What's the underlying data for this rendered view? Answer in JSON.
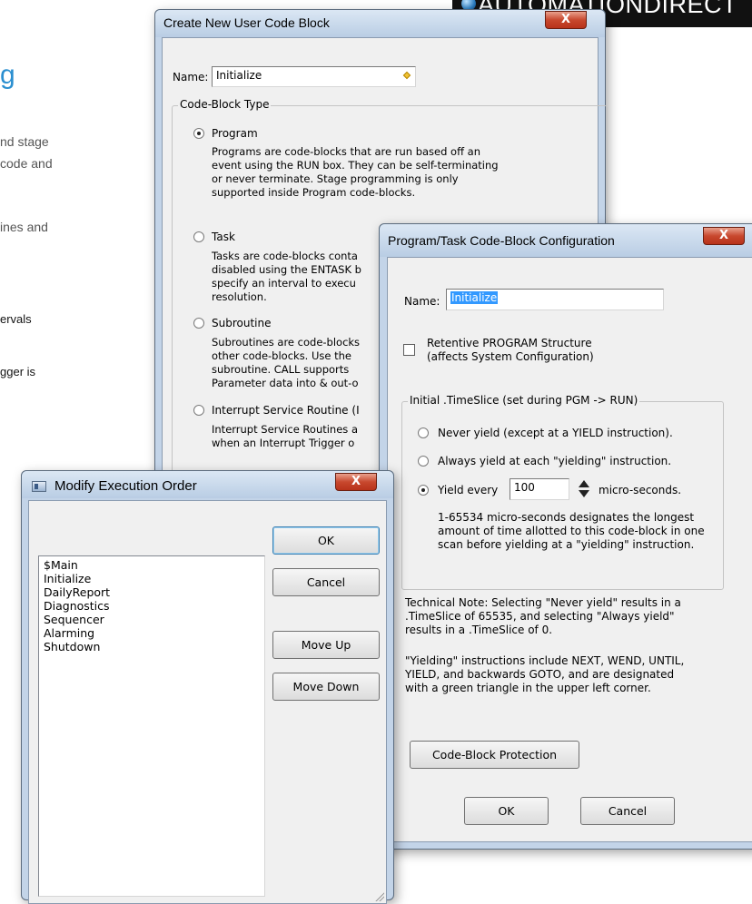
{
  "background_page": {
    "heading_fragment": "g",
    "lines": [
      "nd stage",
      "code and",
      "ines and",
      "ervals",
      "gger is"
    ],
    "brand": "AUTOMATIONDIRECT"
  },
  "create_block_dialog": {
    "title": "Create New User Code Block",
    "close_label": "X",
    "name_label": "Name:",
    "name_value": "Initialize",
    "group_label": "Code-Block Type",
    "options": [
      {
        "label": "Program",
        "checked": true,
        "description": "Programs are code-blocks that are run based off an event using the RUN box. They can be self-terminating or never terminate.  Stage programming is only supported inside Program code-blocks."
      },
      {
        "label": "Task",
        "checked": false,
        "description": "Tasks are code-blocks conta disabled using the ENTASK b specify an interval to execu resolution."
      },
      {
        "label": "Subroutine",
        "checked": false,
        "description": "Subroutines are code-blocks other code-blocks.  Use the subroutine.  CALL supports Parameter data into & out-o"
      },
      {
        "label": "Interrupt Service Routine (I",
        "checked": false,
        "description": "Interrupt Service Routines a when an Interrupt Trigger o"
      }
    ]
  },
  "config_dialog": {
    "title": "Program/Task Code-Block Configuration",
    "close_label": "X",
    "name_label": "Name:",
    "name_value": "Initialize",
    "retentive_label_1": "Retentive PROGRAM Structure",
    "retentive_label_2": "(affects System Configuration)",
    "timeslice_group": "Initial .TimeSlice (set during PGM -> RUN)",
    "radio_never": "Never yield (except at a YIELD instruction).",
    "radio_always": "Always yield at each \"yielding\" instruction.",
    "radio_every": "Yield every",
    "yield_value": "100",
    "yield_unit": "micro-seconds.",
    "range_desc_1": "1-65534 micro-seconds designates the longest",
    "range_desc_2": "amount of time allotted to this code-block in one",
    "range_desc_3": "scan before yielding at a \"yielding\" instruction.",
    "tech_note_1": "Technical Note: Selecting \"Never yield\" results in a",
    "tech_note_2": ".TimeSlice of 65535, and selecting \"Always yield\"",
    "tech_note_3": "results in a .TimeSlice of 0.",
    "yield_note_1": "\"Yielding\" instructions include NEXT, WEND, UNTIL,",
    "yield_note_2": "YIELD, and backwards GOTO, and are designated",
    "yield_note_3": "with a green triangle in the upper left corner.",
    "protection_button": "Code-Block Protection",
    "ok_button": "OK",
    "cancel_button": "Cancel"
  },
  "execution_order_dialog": {
    "title": "Modify Execution Order",
    "close_label": "X",
    "items": [
      "$Main",
      "Initialize",
      "DailyReport",
      "Diagnostics",
      "Sequencer",
      "Alarming",
      "Shutdown"
    ],
    "ok_button": "OK",
    "cancel_button": "Cancel",
    "move_up_button": "Move Up",
    "move_down_button": "Move Down"
  }
}
